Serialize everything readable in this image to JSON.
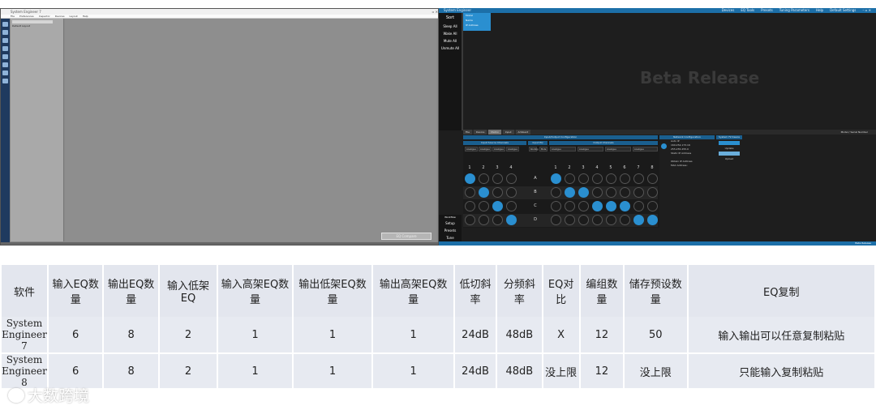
{
  "left_window": {
    "title": "System Engineer 7",
    "menu": [
      "File",
      "Preferences",
      "Inspector",
      "Devices",
      "Layout",
      "Help"
    ],
    "tree_item": "Default Layout",
    "canvas_button": "EQ Compare"
  },
  "right_window": {
    "title": "System Engineer",
    "title_menu": [
      "Devices",
      "EQ Tools",
      "Presets",
      "Tuning Parameters",
      "Help",
      "Default Settings"
    ],
    "sidebar": {
      "sort_label": "Sort",
      "buttons": [
        "Sleep All",
        "Wake All",
        "Mute All",
        "Unmute All"
      ]
    },
    "dropdown_options": [
      "Model",
      "Name",
      "IP Address"
    ],
    "canvas_label": "Beta Release",
    "tabs": [
      "File",
      "Device",
      "Matrix",
      "Input",
      "Ambient"
    ],
    "tab_right": "Model / Serial Number",
    "matrix": {
      "title": "Input/Output Configuration",
      "input_header": "Input Source Channels",
      "eq_header": "Input EQ",
      "output_header": "Output Channels",
      "input_channels": [
        "1",
        "2",
        "3",
        "4"
      ],
      "output_channels": [
        "1",
        "2",
        "3",
        "4",
        "5",
        "6",
        "7",
        "8"
      ],
      "rows": [
        "A",
        "B",
        "C",
        "D"
      ],
      "input_select": [
        "Analogue",
        "Analogue",
        "Analogue",
        "Analogue"
      ],
      "output_select": [
        "Analogue",
        "Analogue",
        "Analogue",
        "Analogue"
      ],
      "routing_label": "Routing",
      "mute_label": "Mute"
    },
    "network": {
      "title": "Network Configuration",
      "lines": [
        "Auto IP",
        "169.254.173.16",
        "255.255.255.0",
        "Static IP Address",
        "",
        "Obtain IP Address",
        "MAC Address:"
      ]
    },
    "update": {
      "title": "System Firmware",
      "lines": [
        "Update",
        "Upload"
      ]
    },
    "bottom_sidebar": {
      "small": "Workflow",
      "buttons": [
        "Setup",
        "Presets",
        "Tune"
      ]
    },
    "status": "Beta Release"
  },
  "table": {
    "headers": [
      "软件",
      "输入EQ数量",
      "输出EQ数量",
      "输入低架EQ",
      "输入高架EQ数量",
      "输出低架EQ数量",
      "输出高架EQ数量",
      "低切斜率",
      "分频斜率",
      "EQ对比",
      "编组数量",
      "储存预设数量",
      "EQ复制"
    ],
    "rows": [
      [
        "System Engineer 7",
        "6",
        "8",
        "2",
        "1",
        "1",
        "1",
        "24dB",
        "48dB",
        "X",
        "12",
        "50",
        "输入输出可以任意复制粘贴"
      ],
      [
        "System Engineer 8",
        "6",
        "8",
        "2",
        "1",
        "1",
        "1",
        "24dB",
        "48dB",
        "没上限",
        "12",
        "没上限",
        "只能输入复制粘贴"
      ]
    ]
  },
  "watermark": "大数跨境"
}
